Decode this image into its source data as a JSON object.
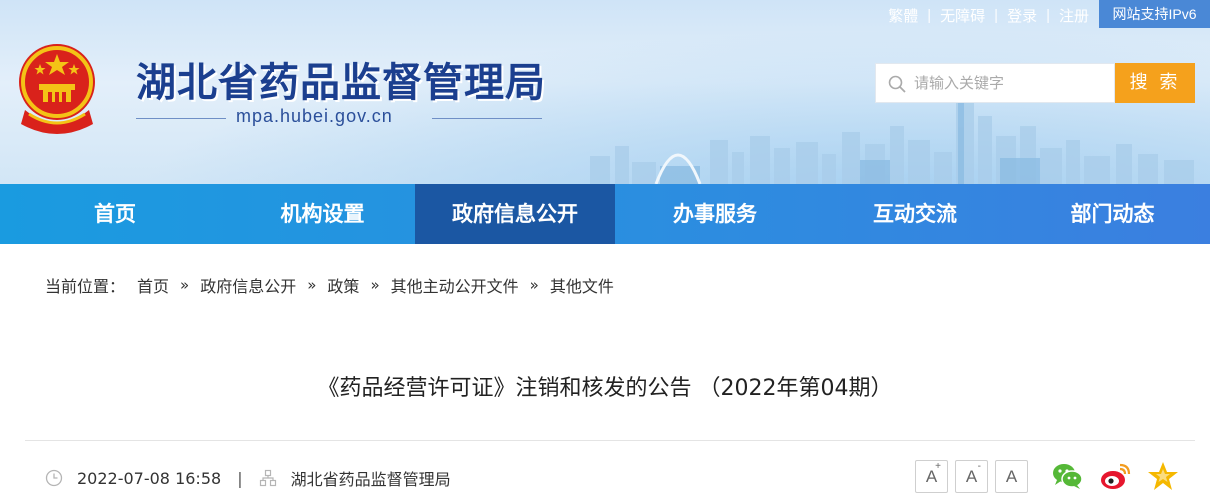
{
  "header": {
    "site_title": "湖北省药品监督管理局",
    "site_domain": "mpa.hubei.gov.cn",
    "top_links": [
      "繁體",
      "无障碍",
      "登录",
      "注册"
    ],
    "ipv6_label": "网站支持IPv6",
    "search": {
      "placeholder": "请输入关键字",
      "button_label": "搜 索"
    },
    "colors": {
      "brand": "#1b3f8f",
      "search_button": "#f5a11c"
    }
  },
  "nav": {
    "items": [
      {
        "label": "首页"
      },
      {
        "label": "机构设置"
      },
      {
        "label": "政府信息公开"
      },
      {
        "label": "办事服务"
      },
      {
        "label": "互动交流"
      },
      {
        "label": "部门动态"
      }
    ],
    "active_index": 2,
    "colors": {
      "bar": "#2a8fe0",
      "active": "#1b57a3"
    }
  },
  "breadcrumb": {
    "prefix": "当前位置：",
    "items": [
      "首页",
      "政府信息公开",
      "政策",
      "其他主动公开文件",
      "其他文件"
    ],
    "separator": "»"
  },
  "article": {
    "title": "《药品经营许可证》注销和核发的公告 （2022年第04期）",
    "datetime": "2022-07-08 16:58",
    "meta_separator": "|",
    "source": "湖北省药品监督管理局",
    "font_buttons": [
      "A+",
      "A-",
      "A"
    ],
    "share_icons": [
      "wechat-icon",
      "weibo-icon",
      "favorite-star-icon"
    ]
  }
}
